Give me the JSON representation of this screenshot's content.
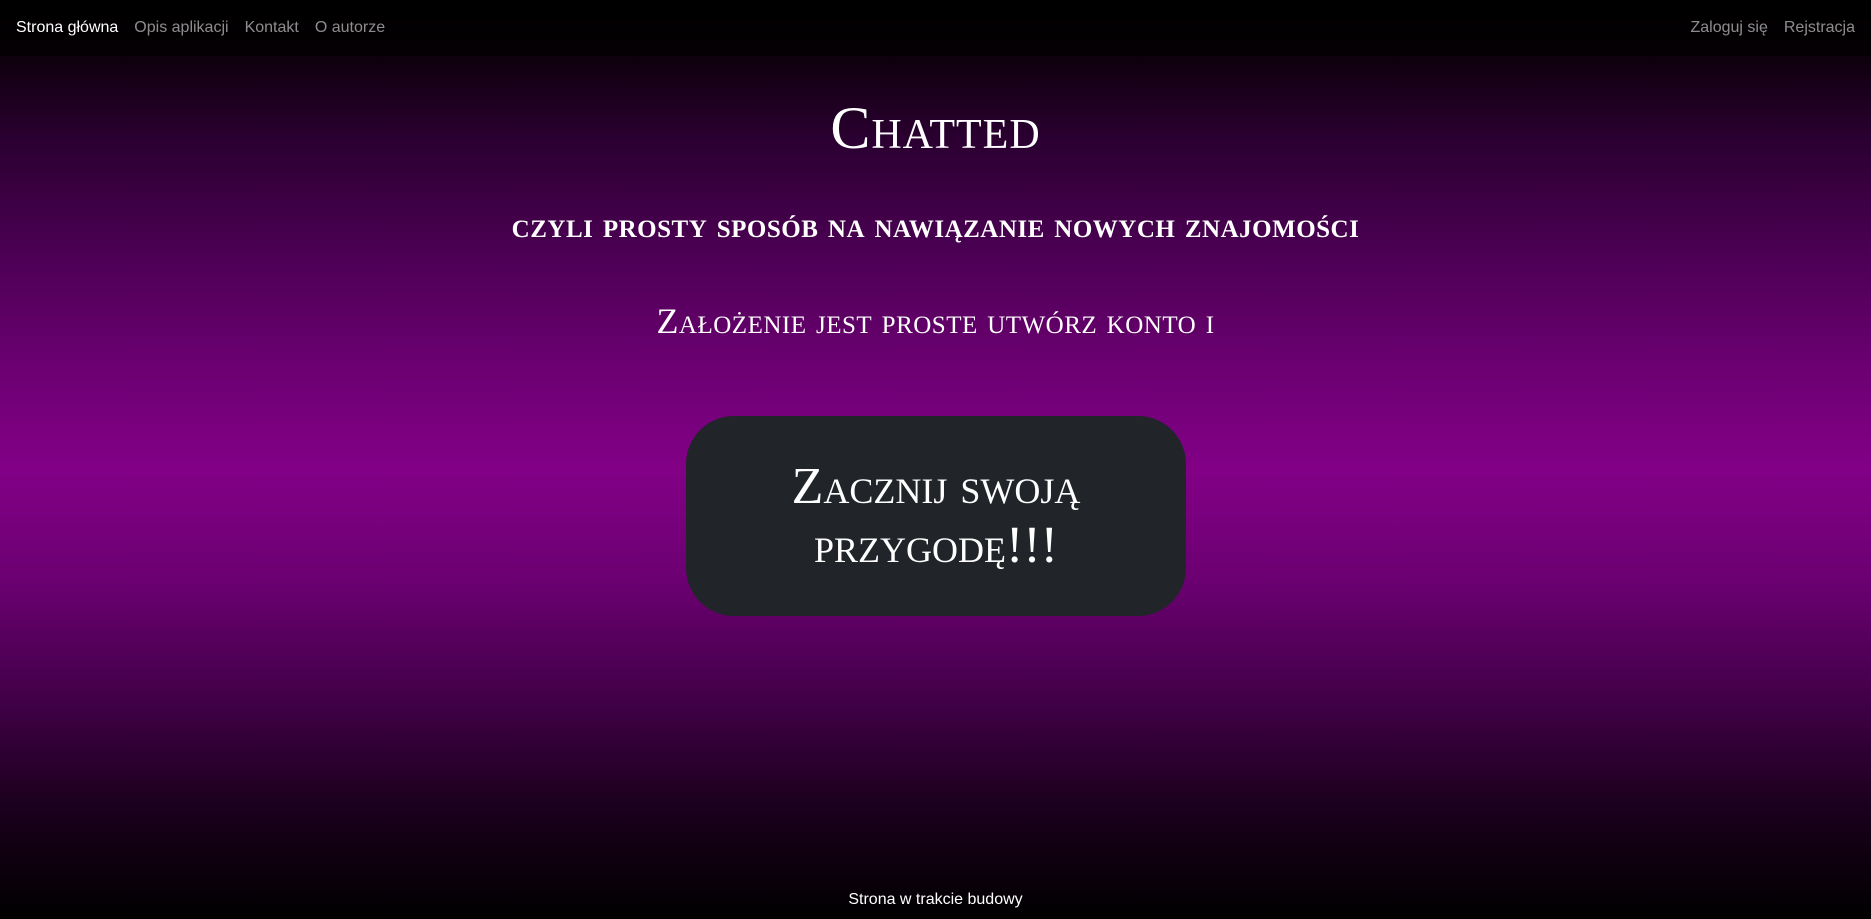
{
  "nav": {
    "left": [
      {
        "label": "Strona główna",
        "active": true
      },
      {
        "label": "Opis aplikacji"
      },
      {
        "label": "Kontakt"
      },
      {
        "label": "O autorze"
      }
    ],
    "right": [
      {
        "label": "Zaloguj się"
      },
      {
        "label": "Rejstracja"
      }
    ]
  },
  "hero": {
    "title": "Chatted",
    "subtitle": "czyli prosty sposób na nawiązanie nowych znajomości",
    "text": "Założenie jest proste utwórz konto i",
    "cta_label": "Zacznij swoją przygodę!!!"
  },
  "footer": {
    "text": "Strona w trakcie budowy"
  },
  "colors": {
    "gradient_center": "#820086",
    "button_bg": "#212529",
    "nav_text_muted": "rgba(255,255,255,0.55)"
  }
}
